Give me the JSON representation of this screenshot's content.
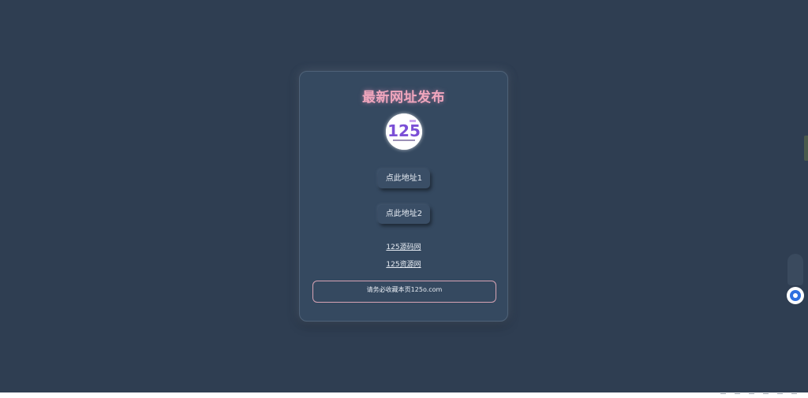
{
  "card": {
    "title": "最新网址发布",
    "logo_text": "125",
    "button1_label": "点此地址1",
    "button2_label": "点此地址2",
    "link1_label": "125源码网",
    "link2_label": "125资源网",
    "notice": "请务必收藏本页125o.com"
  },
  "icons": {
    "side_button": "assistant-icon",
    "logo": "site-logo"
  },
  "colors": {
    "background": "#2f3e52",
    "card": "#354960",
    "title": "#f0a6bd",
    "notice_border": "#d7a3b4"
  }
}
